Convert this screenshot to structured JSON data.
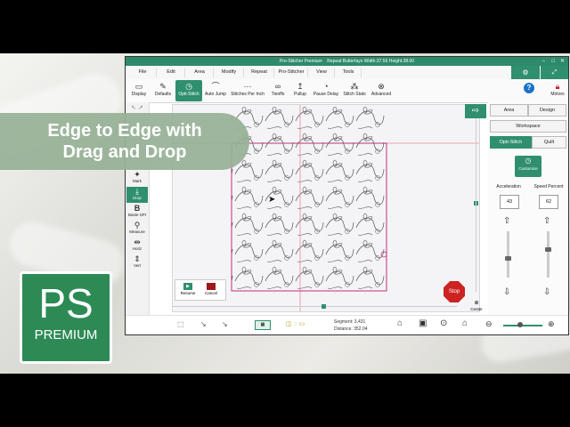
{
  "window": {
    "title": "Pro-Stitcher Premium",
    "pattern_info": "Repeat Butterfays  Width:37.56  Height:38.00"
  },
  "menu": [
    "File",
    "Edit",
    "Area",
    "Modify",
    "Repeat",
    "Pro-Stitcher",
    "View",
    "Tools"
  ],
  "toolbar": [
    {
      "label": "Display",
      "icon": "display-icon"
    },
    {
      "label": "Defaults",
      "icon": "defaults-icon"
    },
    {
      "label": "Opti-Stitch",
      "icon": "opti-stitch-icon",
      "active": true
    },
    {
      "label": "Auto Jump",
      "icon": "auto-jump-icon"
    },
    {
      "label": "Stitches Per Inch",
      "icon": "spi-icon"
    },
    {
      "label": "Tieoffs",
      "icon": "tieoffs-icon"
    },
    {
      "label": "Pullup",
      "icon": "pullup-icon"
    },
    {
      "label": "Pause Delay",
      "icon": "pause-delay-icon"
    },
    {
      "label": "Stitch Stats",
      "icon": "stitch-stats-icon"
    },
    {
      "label": "Advanced",
      "icon": "advanced-icon"
    }
  ],
  "top_right": {
    "help": "?",
    "motors": "Motors"
  },
  "sidebar": [
    {
      "label": "Mark",
      "icon": "mark-icon"
    },
    {
      "label": "Drop",
      "icon": "drop-icon",
      "active": true
    },
    {
      "label": "Baste SPI",
      "icon": "baste-icon"
    },
    {
      "label": "Measure",
      "icon": "measure-icon"
    },
    {
      "label": "Horiz",
      "icon": "horiz-icon"
    },
    {
      "label": "Vert",
      "icon": "vert-icon"
    }
  ],
  "right_panel": {
    "tabs_row1": [
      "Area",
      "Design"
    ],
    "tab_workspace": "Workspace",
    "tabs_row2": [
      "Opti-Stitch",
      "Quilt"
    ],
    "customize": "Customize",
    "acceleration_label": "Acceleration",
    "acceleration_value": "43",
    "speed_label": "Speed Percent",
    "speed_value": "62"
  },
  "canvas": {
    "resume_label": "Resume",
    "cancel_label": "Cancel",
    "stop_label": "Stop",
    "center_label": "Center"
  },
  "status": {
    "segment": "Segment: 3,431",
    "distance": "Distance: 352.04"
  },
  "overlay": {
    "line1": "Edge to Edge with",
    "line2": "Drag and Drop"
  },
  "logo": {
    "big": "PS",
    "small": "PREMIUM"
  },
  "colors": {
    "accent": "#2f8f6f",
    "banner": "#96b096",
    "logo": "#2d8a55",
    "stop": "#cc2222",
    "area": "#c0307a"
  }
}
